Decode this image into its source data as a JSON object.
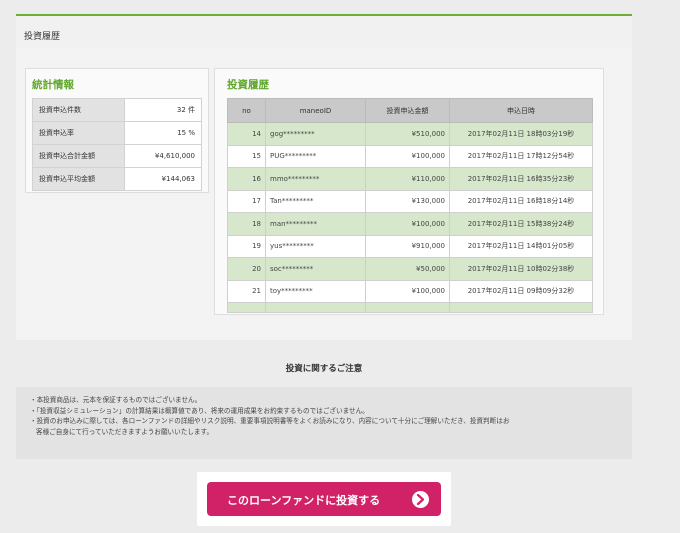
{
  "section": {
    "title": "投資履歴"
  },
  "stats": {
    "title": "統計情報",
    "rows": [
      {
        "label": "投資申込件数",
        "value": "32 件"
      },
      {
        "label": "投資申込率",
        "value": "15 %"
      },
      {
        "label": "投資申込合計金額",
        "value": "¥4,610,000"
      },
      {
        "label": "投資申込平均金額",
        "value": "¥144,063"
      }
    ]
  },
  "history": {
    "title": "投資履歴",
    "columns": [
      "no",
      "maneoID",
      "投資申込金額",
      "申込日時"
    ],
    "rows": [
      {
        "no": "14",
        "id": "gog*********",
        "amount": "¥510,000",
        "date": "2017年02月11日 18時03分19秒"
      },
      {
        "no": "15",
        "id": "PUG*********",
        "amount": "¥100,000",
        "date": "2017年02月11日 17時12分54秒"
      },
      {
        "no": "16",
        "id": "mmo*********",
        "amount": "¥110,000",
        "date": "2017年02月11日 16時35分23秒"
      },
      {
        "no": "17",
        "id": "Tan*********",
        "amount": "¥130,000",
        "date": "2017年02月11日 16時18分14秒"
      },
      {
        "no": "18",
        "id": "man*********",
        "amount": "¥100,000",
        "date": "2017年02月11日 15時38分24秒"
      },
      {
        "no": "19",
        "id": "yus*********",
        "amount": "¥910,000",
        "date": "2017年02月11日 14時01分05秒"
      },
      {
        "no": "20",
        "id": "soc*********",
        "amount": "¥50,000",
        "date": "2017年02月11日 10時02分38秒"
      },
      {
        "no": "21",
        "id": "toy*********",
        "amount": "¥100,000",
        "date": "2017年02月11日 09時09分32秒"
      }
    ]
  },
  "notice": {
    "title": "投資に関するご注意",
    "lines": [
      "・本投資商品は、元本を保証するものではございません。",
      "・「投資収益シミュレーション」の計算結果は概算値であり、将来の運用成果をお約束するものではございません。",
      "・投資のお申込みに際しては、各ローンファンドの詳細やリスク説明、重要事項説明書等をよくお読みになり、内容について十分にご理解いただき、投資判断はお",
      "客様ご自身にて行っていただきますようお願いいたします。"
    ]
  },
  "cta": {
    "label": "このローンファンドに投資する",
    "icon": "chevron-right-icon"
  }
}
